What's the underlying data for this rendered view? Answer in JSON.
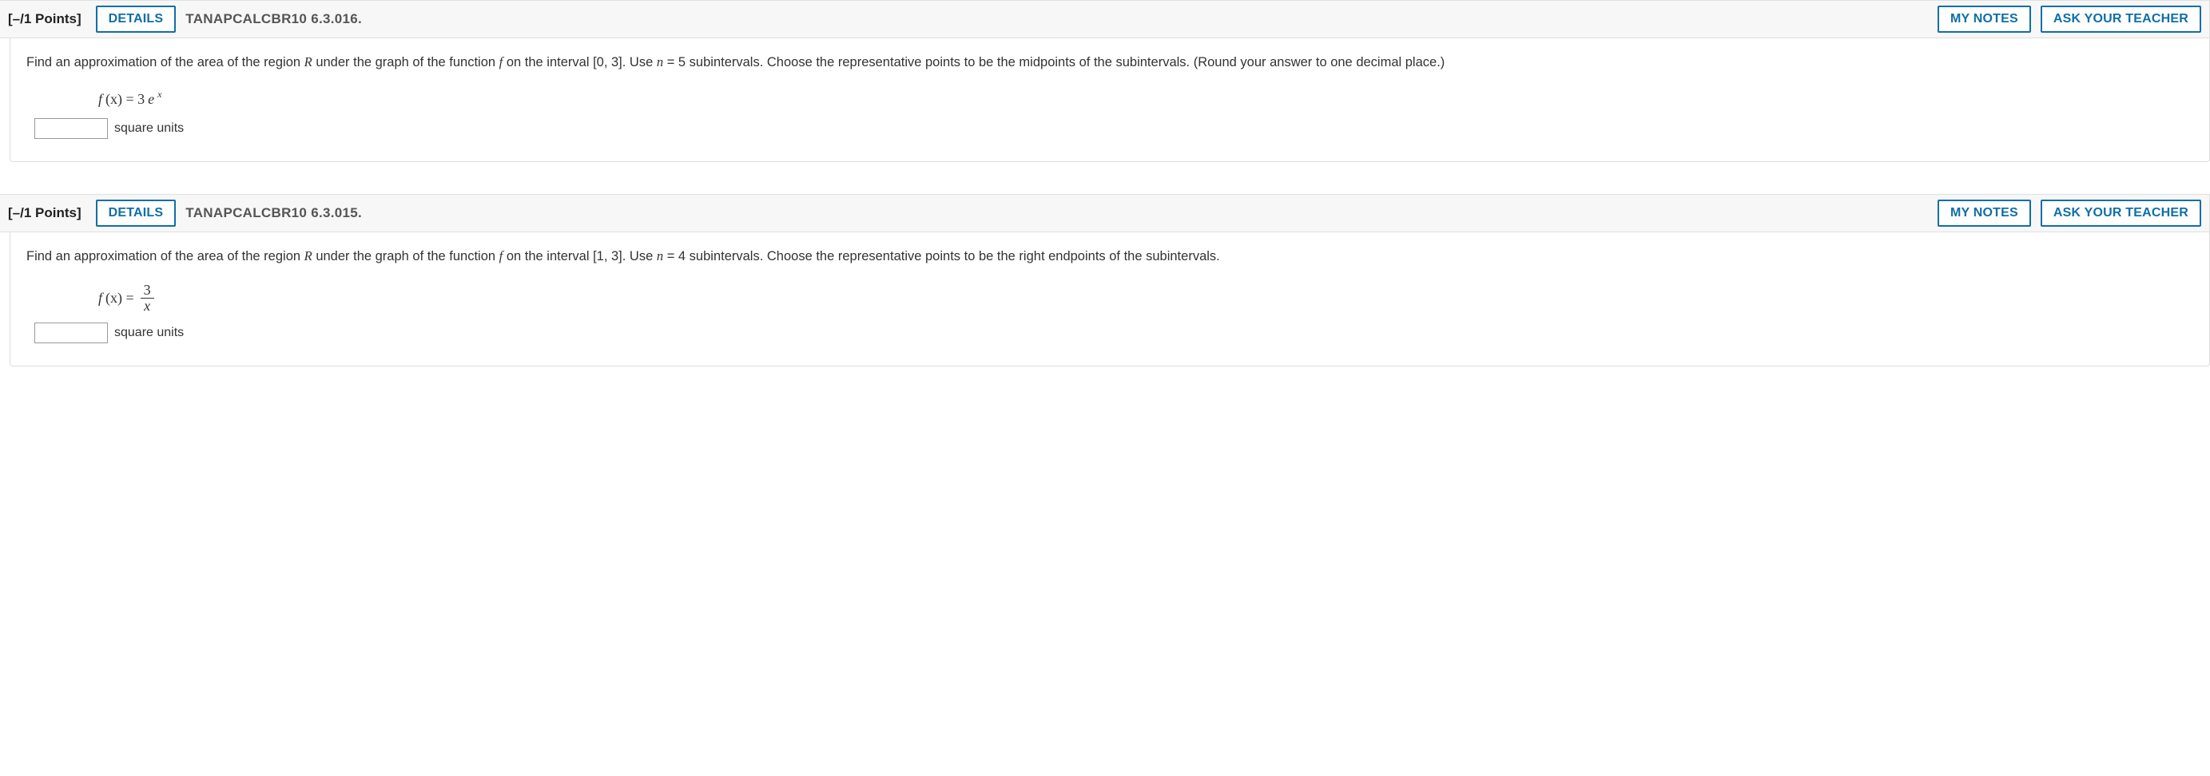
{
  "questions": [
    {
      "points": "[–/1 Points]",
      "details_label": "DETAILS",
      "code": "TANAPCALCBR10 6.3.016.",
      "mynotes_label": "MY NOTES",
      "ask_label": "ASK YOUR TEACHER",
      "prompt_pre": "Find an approximation of the area of the region ",
      "R": "R",
      "prompt_mid1": " under the graph of the function ",
      "f": "f",
      "prompt_mid2": " on the interval [0, 3]. Use ",
      "n": "n",
      "prompt_mid3": " = 5 subintervals. Choose the representative points to be the midpoints of the subintervals. (Round your answer to one decimal place.)",
      "fx": "f",
      "fx_paren": "(x) = 3",
      "e": "e",
      "exp": "x",
      "units": "square units"
    },
    {
      "points": "[–/1 Points]",
      "details_label": "DETAILS",
      "code": "TANAPCALCBR10 6.3.015.",
      "mynotes_label": "MY NOTES",
      "ask_label": "ASK YOUR TEACHER",
      "prompt_pre": "Find an approximation of the area of the region ",
      "R": "R",
      "prompt_mid1": " under the graph of the function ",
      "f": "f",
      "prompt_mid2": " on the interval [1, 3]. Use ",
      "n": "n",
      "prompt_mid3": " = 4 subintervals. Choose the representative points to be the right endpoints of the subintervals.",
      "fx": "f",
      "fx_paren": "(x) = ",
      "frac_num": "3",
      "frac_den": "x",
      "units": "square units"
    }
  ]
}
